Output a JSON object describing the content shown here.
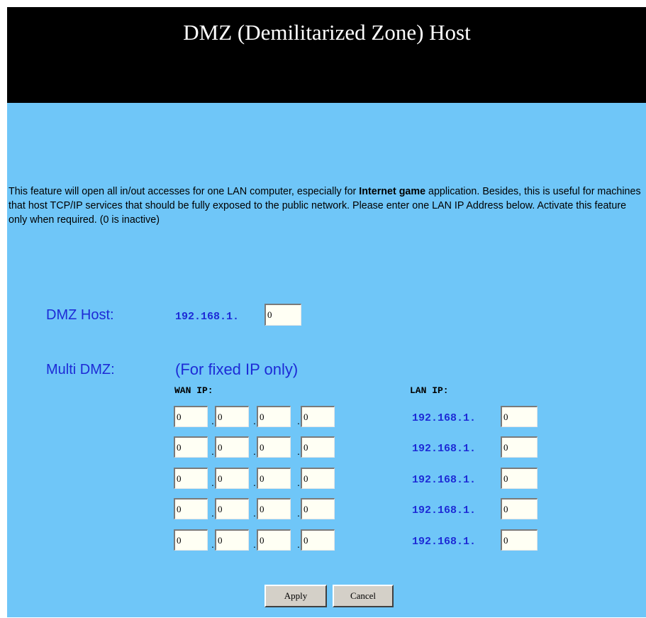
{
  "header": {
    "title": "DMZ (Demilitarized Zone) Host"
  },
  "description": {
    "part1": "This feature will open all in/out accesses for one LAN computer, especially for ",
    "bold": "Internet game",
    "part2": " application. Besides, this is useful for machines that host TCP/IP services that should be fully exposed to the public network. Please enter one LAN IP Address below. Activate this feature only when required. (0 is inactive)"
  },
  "dmz_host": {
    "label": "DMZ Host:",
    "prefix": "192.168.1.",
    "value": "0"
  },
  "multi_dmz": {
    "label": "Multi DMZ:",
    "note": "(For fixed IP only)",
    "wan_header": "WAN IP:",
    "lan_header": "LAN IP:",
    "dot": ".",
    "rows": [
      {
        "wan": [
          "0",
          "0",
          "0",
          "0"
        ],
        "lan_prefix": "192.168.1.",
        "lan": "0"
      },
      {
        "wan": [
          "0",
          "0",
          "0",
          "0"
        ],
        "lan_prefix": "192.168.1.",
        "lan": "0"
      },
      {
        "wan": [
          "0",
          "0",
          "0",
          "0"
        ],
        "lan_prefix": "192.168.1.",
        "lan": "0"
      },
      {
        "wan": [
          "0",
          "0",
          "0",
          "0"
        ],
        "lan_prefix": "192.168.1.",
        "lan": "0"
      },
      {
        "wan": [
          "0",
          "0",
          "0",
          "0"
        ],
        "lan_prefix": "192.168.1.",
        "lan": "0"
      }
    ]
  },
  "buttons": {
    "apply": "Apply",
    "cancel": "Cancel"
  }
}
